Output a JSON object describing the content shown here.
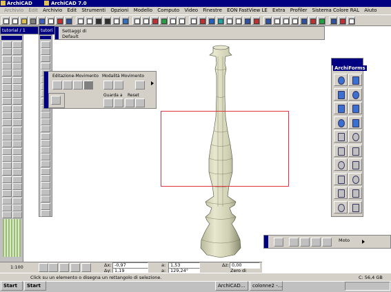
{
  "title_bar": {
    "title": "ArchiCAD 7.0",
    "left_label": "ArchiCAD"
  },
  "menu": {
    "items": [
      "Archivio",
      "Edit",
      "Archivio",
      "Edit",
      "Strumenti",
      "Opzioni",
      "Modello",
      "Computo",
      "Video",
      "Finestre",
      "EON FastView LE",
      "Extra",
      "Profiler",
      "Sistema Colore RAL",
      "Aiuto"
    ]
  },
  "tabs": {
    "tutorial": "tutorial / 1",
    "tutorial_short": "tutori"
  },
  "info_palette": {
    "line1": "Settaggi di",
    "line2": "Default"
  },
  "edit_palette": {
    "section1": "Editazione-Movimento",
    "section2": "Modalità Movimento",
    "guarda_label": "Guarda a",
    "reset_label": "Reset"
  },
  "archiforms": {
    "title": "ArchiForms"
  },
  "coords": {
    "dx_label": "Δx:",
    "dx_value": "-0,97",
    "dy_label": "Δy:",
    "dy_value": "1,19",
    "a_label": "a:",
    "a_value": "1,53",
    "angle_label": "a:",
    "angle_value": "129,24°",
    "dz_label": "Δz:",
    "dz_value": "0,00",
    "zero_label": "Zero di Progetto",
    "scale": "1:100"
  },
  "status": {
    "message": "Click su un elemento o disegna un rettangolo di selezione.",
    "disk": "C: 56,4 GB"
  },
  "bottom_right_palette": {
    "label": "Moto"
  },
  "taskbar": {
    "start1": "Start",
    "start2": "Start",
    "items": [
      "ArchiCAD...",
      "colonne2 -..."
    ]
  }
}
